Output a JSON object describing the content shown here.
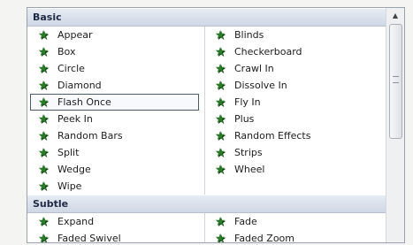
{
  "sections": [
    {
      "title": "Basic",
      "left": [
        "Appear",
        "Box",
        "Circle",
        "Diamond",
        "Flash Once",
        "Peek In",
        "Random Bars",
        "Split",
        "Wedge",
        "Wipe"
      ],
      "right": [
        "Blinds",
        "Checkerboard",
        "Crawl In",
        "Dissolve In",
        "Fly In",
        "Plus",
        "Random Effects",
        "Strips",
        "Wheel"
      ]
    },
    {
      "title": "Subtle",
      "left": [
        "Expand",
        "Faded Swivel"
      ],
      "right": [
        "Fade",
        "Faded Zoom"
      ]
    }
  ],
  "selected_item": "Flash Once",
  "icon": "effect-star-icon",
  "colors": {
    "star": "#2a7a2a",
    "header_bg": "#d8e0eb",
    "selection_border": "#4c5a6b"
  },
  "scrollbar": {
    "up_arrow": "▲",
    "position": 0
  }
}
